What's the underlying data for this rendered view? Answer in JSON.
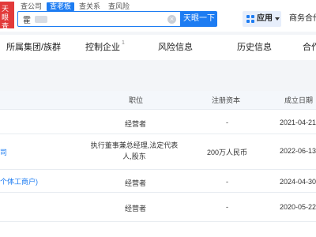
{
  "logo": {
    "text": "天眼查"
  },
  "search": {
    "tabs": [
      "查公司",
      "查老板",
      "查关系",
      "查风险"
    ],
    "active_tab": 1,
    "value": "霍",
    "button_label": "天眼一下"
  },
  "header": {
    "app_label": "应用",
    "biz_label": "商务合作"
  },
  "nav": {
    "items": [
      {
        "label": "所属集团/族群",
        "sup": ""
      },
      {
        "label": "控制企业",
        "sup": "1"
      },
      {
        "label": "风险信息",
        "sup": ""
      },
      {
        "label": "历史信息",
        "sup": ""
      },
      {
        "label": "合作",
        "sup": ""
      }
    ]
  },
  "table": {
    "columns": [
      "职位",
      "注册资本",
      "成立日期"
    ],
    "rows": [
      {
        "company": "",
        "position": "经营者",
        "capital": "-",
        "date": "2021-04-21"
      },
      {
        "company": "司",
        "position": "执行董事兼总经理,法定代表人,股东",
        "capital": "200万人民币",
        "date": "2022-06-13"
      },
      {
        "company": "个体工商户)",
        "position": "经营者",
        "capital": "-",
        "date": "2024-04-30"
      },
      {
        "company": "",
        "position": "经营者",
        "capital": "-",
        "date": "2020-05-22"
      }
    ]
  },
  "colors": {
    "accent": "#1d7cf2",
    "brand_red": "#e23a3a"
  }
}
